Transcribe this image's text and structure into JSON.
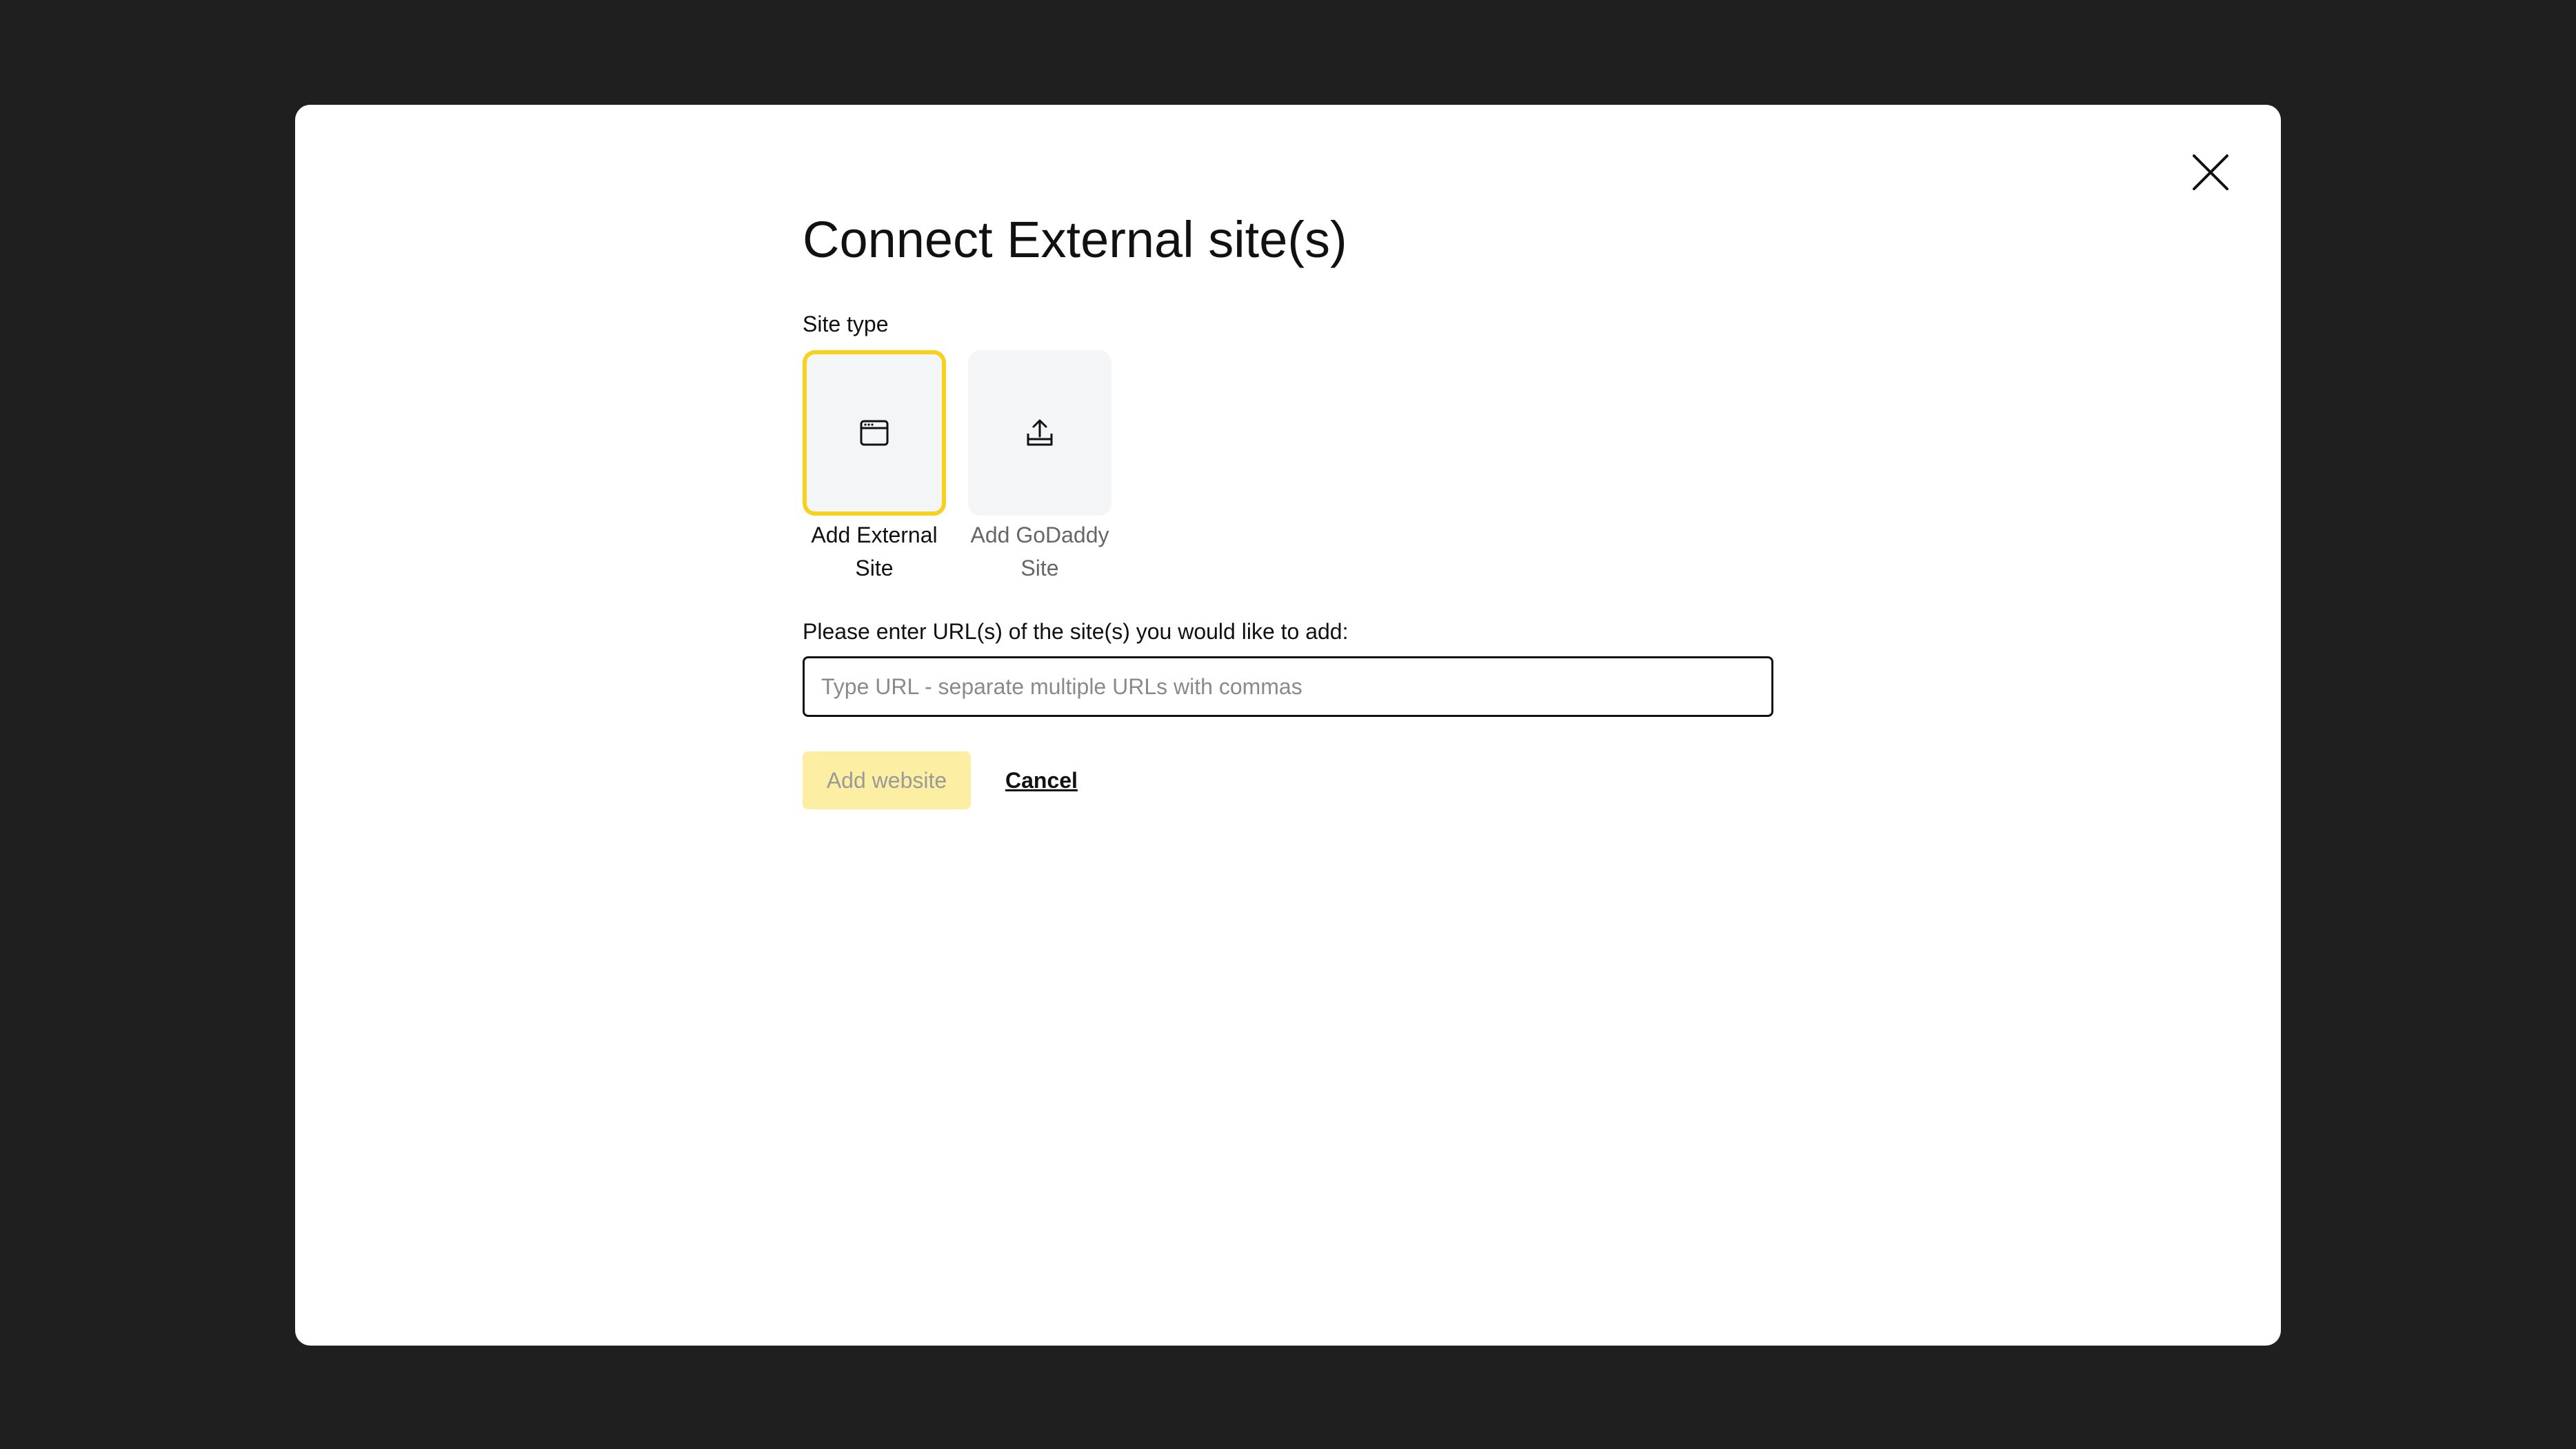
{
  "modal": {
    "title": "Connect External site(s)",
    "close_icon": "close-icon"
  },
  "site_type": {
    "label": "Site type",
    "options": [
      {
        "label_line1": "Add External",
        "label_line2": "Site",
        "icon": "browser-window-icon",
        "selected": true
      },
      {
        "label_line1": "Add GoDaddy",
        "label_line2": "Site",
        "icon": "upload-icon",
        "selected": false
      }
    ]
  },
  "url_field": {
    "label": "Please enter URL(s) of the site(s) you would like to add:",
    "value": "",
    "placeholder": "Type URL - separate multiple URLs with commas"
  },
  "actions": {
    "add_label": "Add website",
    "add_enabled": false,
    "cancel_label": "Cancel"
  },
  "colors": {
    "backdrop": "#1f1f1f",
    "selected_border": "#f6d21f",
    "disabled_button": "#fceea3",
    "tile_background": "#f4f5f6"
  }
}
